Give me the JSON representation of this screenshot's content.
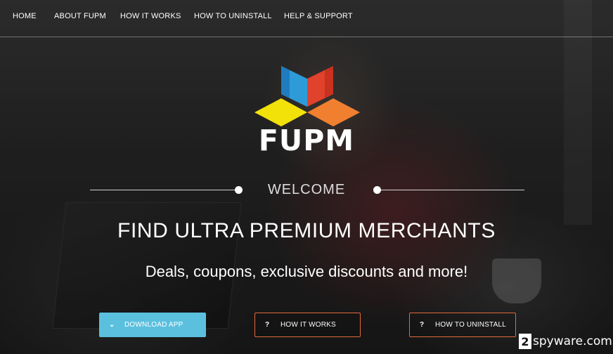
{
  "nav": {
    "items": [
      {
        "label": "HOME"
      },
      {
        "label": "ABOUT FUPM"
      },
      {
        "label": "HOW IT WORKS"
      },
      {
        "label": "HOW TO UNINSTALL"
      },
      {
        "label": "HELP & SUPPORT"
      }
    ]
  },
  "logo": {
    "text": "FUPM",
    "colors": {
      "blue": "#2e9bd9",
      "red": "#e0422c",
      "yellow": "#f2e20a",
      "orange": "#f08030"
    }
  },
  "hero": {
    "welcome": "WELCOME",
    "headline": "FIND ULTRA PREMIUM MERCHANTS",
    "subhead": "Deals, coupons, exclusive discounts and more!"
  },
  "buttons": {
    "download": {
      "label": "DOWNLOAD APP",
      "icon": "chevron-down-icon",
      "color": "#5bc0de"
    },
    "how_it_works": {
      "label": "HOW IT WORKS",
      "icon": "question-icon",
      "border": "#e26a3b"
    },
    "how_to_uninstall": {
      "label": "HOW TO UNINSTALL",
      "icon": "question-icon",
      "border": "#e26a3b"
    }
  },
  "watermark": {
    "badge": "2",
    "text": "spyware.com"
  }
}
